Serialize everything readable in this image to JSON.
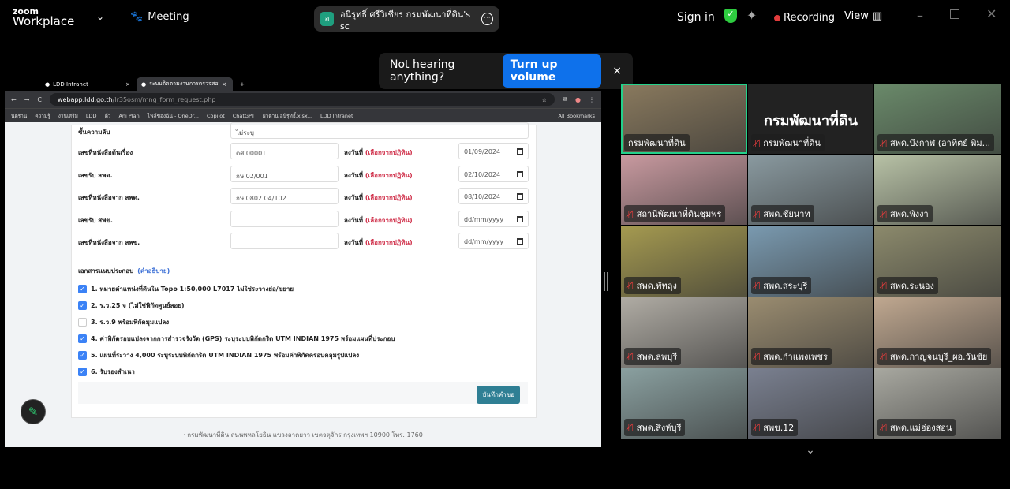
{
  "zoom": {
    "brand_top": "zoom",
    "brand_bottom": "Workplace",
    "meeting_label": "Meeting",
    "share_avatar": "อ",
    "share_title": "อนิรุทธิ์ ศรีวิเชียร กรมพัฒนาที่ดิน's sc",
    "sign_in": "Sign in",
    "recording": "Recording",
    "view": "View"
  },
  "popup": {
    "text": "Not hearing anything?",
    "button": "Turn up volume",
    "close": "×"
  },
  "browser": {
    "tabs": [
      {
        "label": "LDD Intranet"
      },
      {
        "label": "ระบบติดตามงานการตรวจสอบร"
      }
    ],
    "url_host": "webapp.ldd.go.th",
    "url_path": "/lr35osm/mng_form_request.php",
    "bookmarks": [
      "นตราน",
      "ความรู้",
      "งานเสริม",
      "LDD",
      "ตัว",
      "Ani Plan",
      "ไฟล์ของฉัน - OneDr...",
      "Copilot",
      "ChatGPT",
      "ผ่าตาน อนิรุทธิ์.xlsx...",
      "LDD Intranet"
    ],
    "all_bookmarks": "All Bookmarks"
  },
  "form": {
    "secret_label": "ชั้นความลับ",
    "secret_value": "ไม่ระบุ",
    "date_label": "ลงวันที่",
    "date_hint": "(เลือกจากปฏิทิน)",
    "rows": [
      {
        "label": "เลขที่หนังสือต้นเรื่อง",
        "value": "ตศ 00001",
        "date": "01/09/2024"
      },
      {
        "label": "เลขรับ สพด.",
        "value": "กษ 02/001",
        "date": "02/10/2024"
      },
      {
        "label": "เลขที่หนังสือจาก สพด.",
        "value": "กษ 0802.04/102",
        "date": "08/10/2024"
      },
      {
        "label": "เลขรับ สพข.",
        "value": "",
        "date": "dd/mm/yyyy"
      },
      {
        "label": "เลขที่หนังสือจาก สพข.",
        "value": "",
        "date": "dd/mm/yyyy"
      }
    ],
    "attach_label": "เอกสารแนบประกอบ",
    "attach_link": "(คำอธิบาย)",
    "checks": [
      {
        "label": "1. หมายตำแหน่งที่ดินใน Topo 1:50,000 L7017 ไม่ใช่ระวางย่อ/ขยาย",
        "checked": true
      },
      {
        "label": "2. ร.ว.25 จ (ไม่ใช่พิกัดศูนย์ลอย)",
        "checked": true
      },
      {
        "label": "3. ร.ว.9 พร้อมพิกัดมุมแปลง",
        "checked": false
      },
      {
        "label": "4. ค่าพิกัดรอบแปลงจากการสำรวจรังวัด (GPS) ระบุระบบพิกัดกริด UTM INDIAN 1975 พร้อมแผนที่ประกอบ",
        "checked": true
      },
      {
        "label": "5. แผนที่ระวาง 4,000 ระบุระบบพิกัดกริด UTM INDIAN 1975 พร้อมค่าพิกัดครอบคลุมรูปแปลง",
        "checked": true
      },
      {
        "label": "6. รับรองสำเนา",
        "checked": true
      }
    ],
    "save_button": "บันทึกคำขอ",
    "footer": "กรมพัฒนาที่ดิน ถนนพหลโยธิน แขวงลาดยาว เขตจตุจักร กรุงเทพฯ 10900 โทร. 1760"
  },
  "participants": [
    {
      "name": "กรมพัฒนาที่ดิน",
      "muted": false,
      "active": true,
      "bg": "#8a7a5e"
    },
    {
      "name": "กรมพัฒนาที่ดิน",
      "muted": true,
      "bg": "#222222"
    },
    {
      "name": "สพด.บึงกาฬ (อาทิตย์ พิม...",
      "muted": true,
      "bg": "#6a8a6a"
    },
    {
      "name": "สถานีพัฒนาที่ดินชุมพร",
      "muted": true,
      "bg": "#c99aa0"
    },
    {
      "name": "สพด.ชัยนาท",
      "muted": true,
      "bg": "#8a9aa0"
    },
    {
      "name": "สพด.พังงา",
      "muted": true,
      "bg": "#b8c2a6"
    },
    {
      "name": "สพด.พัทลุง",
      "muted": true,
      "bg": "#a59a50"
    },
    {
      "name": "สพด.สระบุรี",
      "muted": true,
      "bg": "#7a9ab0"
    },
    {
      "name": "สพด.ระนอง",
      "muted": true,
      "bg": "#8c8a6c"
    },
    {
      "name": "สพด.ลพบุรี",
      "muted": true,
      "bg": "#b0aca4"
    },
    {
      "name": "สพด.กำแพงเพชร",
      "muted": true,
      "bg": "#9a8c70"
    },
    {
      "name": "สพด.กาญจนบุรี_ผอ.วันชัย",
      "muted": true,
      "bg": "#c0a890"
    },
    {
      "name": "สพด.สิงห์บุรี",
      "muted": true,
      "bg": "#8aa0a0"
    },
    {
      "name": "สพข.12",
      "muted": true,
      "bg": "#7a8090"
    },
    {
      "name": "สพด.แม่ฮ่องสอน",
      "muted": true,
      "bg": "#a8a8a0"
    }
  ],
  "colors": {
    "accent": "#0e71eb",
    "recording": "#e23c3c",
    "active_speaker": "#23d18b",
    "save_button": "#2f7f94"
  }
}
